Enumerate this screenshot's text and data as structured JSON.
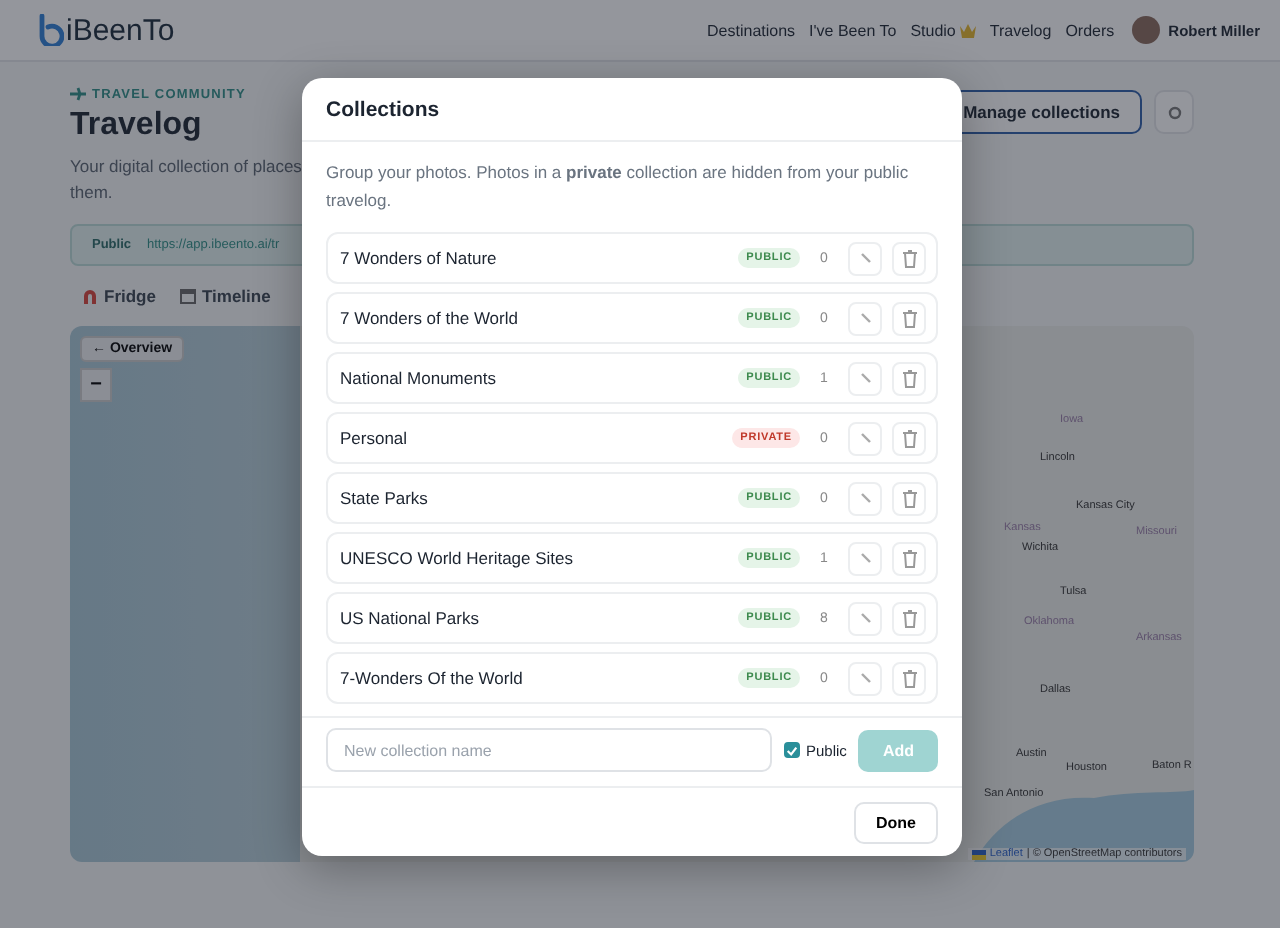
{
  "header": {
    "logo": "iBeenTo",
    "nav": [
      {
        "label": "Destinations",
        "crown": false
      },
      {
        "label": "I've Been To",
        "crown": false
      },
      {
        "label": "Studio",
        "crown": true
      },
      {
        "label": "Travelog",
        "crown": false
      },
      {
        "label": "Orders",
        "crown": false
      }
    ],
    "user": "Robert Miller"
  },
  "page": {
    "eyebrow": "TRAVEL COMMUNITY",
    "title": "Travelog",
    "description_lines": [
      "Your digital collection of places",
      "them."
    ],
    "manage_button": "Manage collections",
    "share": {
      "label": "Public",
      "url": "https://app.ibeento.ai/tr"
    },
    "view_tabs": [
      {
        "label": "Fridge",
        "kind": "magnet"
      },
      {
        "label": "Timeline",
        "kind": "calendar"
      }
    ],
    "map": {
      "overview_button": "← Overview",
      "zoom_out": "−",
      "labels": [
        {
          "text": "Iowa",
          "kind": "region"
        },
        {
          "text": "Lincoln",
          "kind": "city"
        },
        {
          "text": "Kansas City",
          "kind": "city"
        },
        {
          "text": "Kansas",
          "kind": "region"
        },
        {
          "text": "Missouri",
          "kind": "region"
        },
        {
          "text": "Wichita",
          "kind": "city"
        },
        {
          "text": "Tulsa",
          "kind": "city"
        },
        {
          "text": "Oklahoma",
          "kind": "region"
        },
        {
          "text": "Arkansas",
          "kind": "region"
        },
        {
          "text": "Dallas",
          "kind": "city"
        },
        {
          "text": "Austin",
          "kind": "city"
        },
        {
          "text": "Houston",
          "kind": "city"
        },
        {
          "text": "Baton R",
          "kind": "city"
        },
        {
          "text": "San Antonio",
          "kind": "city"
        }
      ],
      "attribution_link": "Leaflet",
      "attribution": "| © OpenStreetMap contributors"
    }
  },
  "modal": {
    "title": "Collections",
    "intro": "Group your photos. Photos in a **private** collection are hidden from your public travelog.",
    "collections": [
      {
        "name": "7 Wonders of Nature",
        "badge": "PUBLIC",
        "private": false,
        "count": "0"
      },
      {
        "name": "7 Wonders of the World",
        "badge": "PUBLIC",
        "private": false,
        "count": "0"
      },
      {
        "name": "National Monuments",
        "badge": "PUBLIC",
        "private": false,
        "count": "1"
      },
      {
        "name": "Personal",
        "badge": "PRIVATE",
        "private": true,
        "count": "0"
      },
      {
        "name": "State Parks",
        "badge": "PUBLIC",
        "private": false,
        "count": "0"
      },
      {
        "name": "UNESCO World Heritage Sites",
        "badge": "PUBLIC",
        "private": false,
        "count": "1"
      },
      {
        "name": "US National Parks",
        "badge": "PUBLIC",
        "private": false,
        "count": "8"
      },
      {
        "name": "7-Wonders Of the World",
        "badge": "PUBLIC",
        "private": false,
        "count": "0"
      }
    ],
    "new_name": {
      "placeholder": "New collection name"
    },
    "public_checkbox": {
      "label": "Public",
      "checked": true
    },
    "add_button": {
      "label": "Add",
      "disabled": true
    },
    "done_button": "Done"
  }
}
